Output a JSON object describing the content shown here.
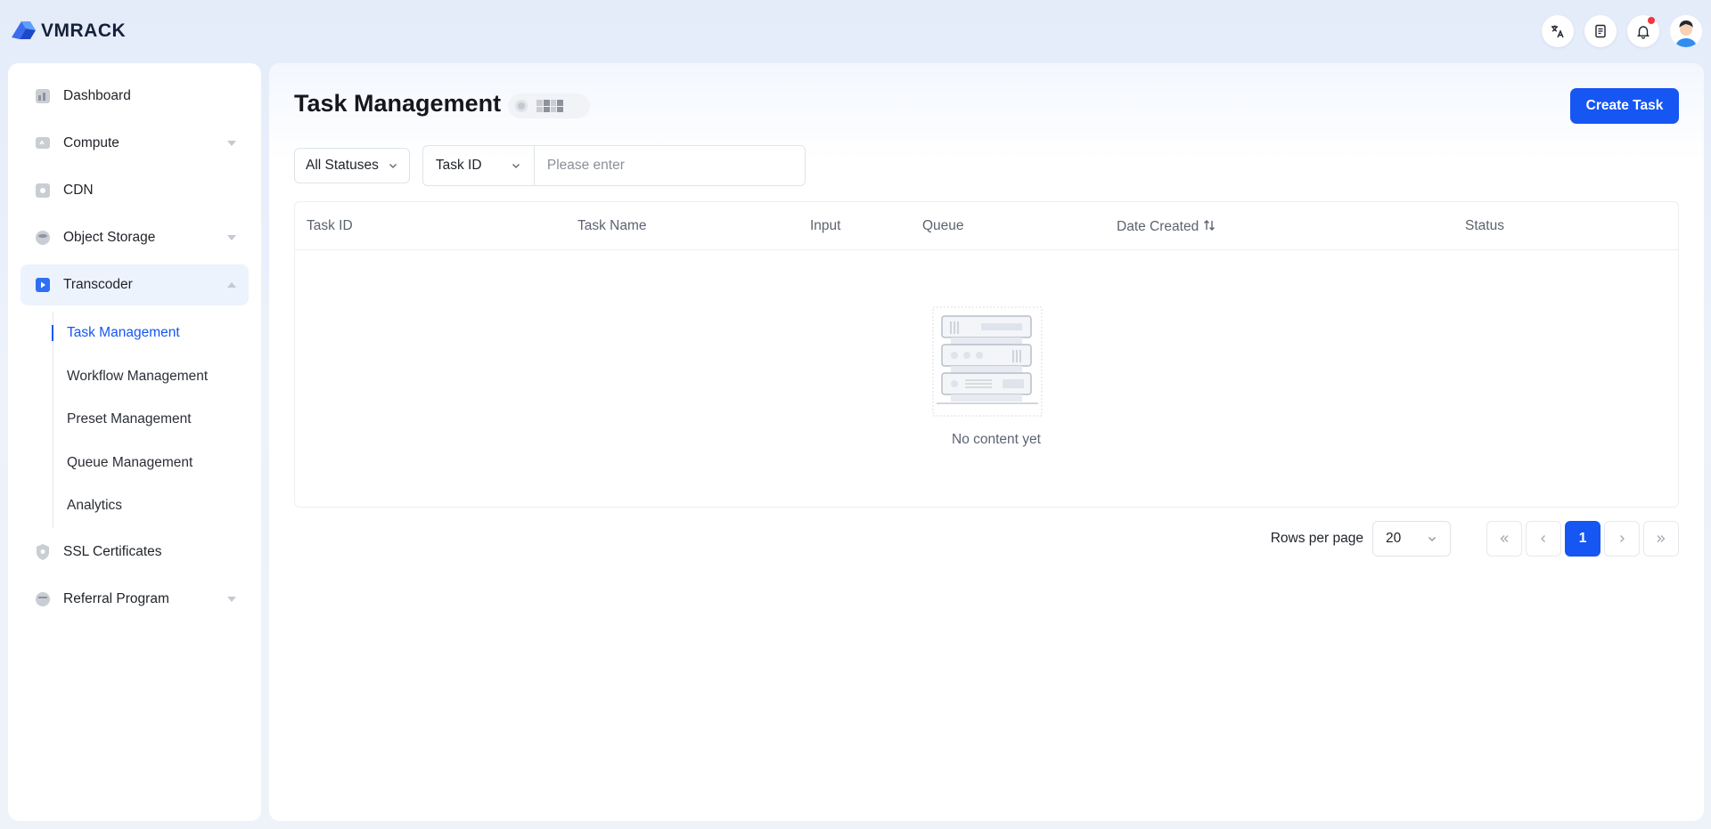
{
  "brand": {
    "name": "VMRACK"
  },
  "sidebar": {
    "items": [
      {
        "label": "Dashboard"
      },
      {
        "label": "Compute"
      },
      {
        "label": "CDN"
      },
      {
        "label": "Object Storage"
      },
      {
        "label": "Transcoder"
      },
      {
        "label": "SSL Certificates"
      },
      {
        "label": "Referral Program"
      }
    ],
    "transcoder_sub": [
      {
        "label": "Task Management"
      },
      {
        "label": "Workflow Management"
      },
      {
        "label": "Preset Management"
      },
      {
        "label": "Queue Management"
      },
      {
        "label": "Analytics"
      }
    ]
  },
  "header": {
    "title": "Task Management",
    "create_label": "Create Task"
  },
  "filters": {
    "status": "All Statuses",
    "field": "Task ID",
    "search_placeholder": "Please enter"
  },
  "table": {
    "columns": [
      "Task ID",
      "Task Name",
      "Input",
      "Queue",
      "Date Created",
      "Status"
    ],
    "empty_text": "No content yet"
  },
  "pagination": {
    "rows_label": "Rows per page",
    "rows_value": "20",
    "current_page": "1"
  },
  "colors": {
    "accent": "#1656f2",
    "notify": "#f5343f"
  }
}
